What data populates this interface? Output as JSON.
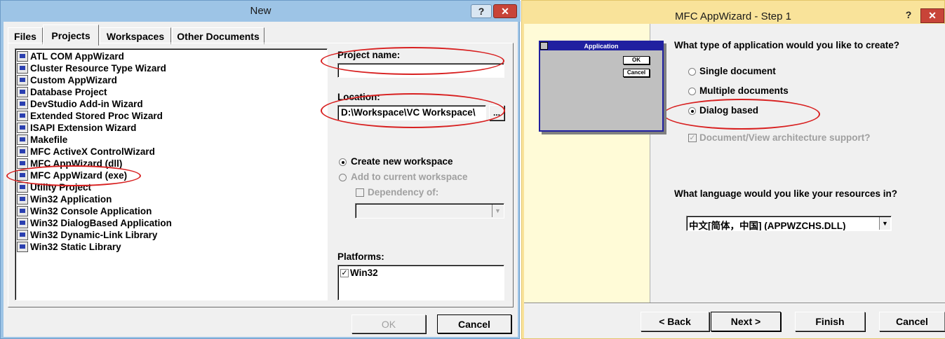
{
  "new_dialog": {
    "title": "New",
    "help_glyph": "?",
    "close_glyph": "✕",
    "tabs": [
      "Files",
      "Projects",
      "Workspaces",
      "Other Documents"
    ],
    "projects": [
      "ATL COM AppWizard",
      "Cluster Resource Type Wizard",
      "Custom AppWizard",
      "Database Project",
      "DevStudio Add-in Wizard",
      "Extended Stored Proc Wizard",
      "ISAPI Extension Wizard",
      "Makefile",
      "MFC ActiveX ControlWizard",
      "MFC AppWizard (dll)",
      "MFC AppWizard (exe)",
      "Utility Project",
      "Win32 Application",
      "Win32 Console Application",
      "Win32 DialogBased Application",
      "Win32 Dynamic-Link Library",
      "Win32 Static Library"
    ],
    "project_name_label": "Project name:",
    "project_name_value": "",
    "location_label": "Location:",
    "location_value": "D:\\Workspace\\VC Workspace\\",
    "browse_label": "...",
    "create_new_workspace": "Create new workspace",
    "add_to_current_workspace": "Add to current workspace",
    "dependency_of": "Dependency of:",
    "platforms_label": "Platforms:",
    "platforms": [
      "Win32"
    ],
    "ok_label": "OK",
    "cancel_label": "Cancel"
  },
  "wizard": {
    "title": "MFC AppWizard - Step 1",
    "help_glyph": "?",
    "close_glyph": "✕",
    "preview_title": "Application",
    "preview_ok": "OK",
    "preview_cancel": "Cancel",
    "question_type": "What type of application would you like to create?",
    "options": [
      "Single document",
      "Multiple documents",
      "Dialog based"
    ],
    "selected_option": "Dialog based",
    "doc_view_support": "Document/View architecture support?",
    "question_language": "What language would you like your resources in?",
    "language_value": "中文[简体，中国] (APPWZCHS.DLL)",
    "back_label": "< Back",
    "next_label": "Next >",
    "finish_label": "Finish",
    "cancel_label": "Cancel"
  }
}
